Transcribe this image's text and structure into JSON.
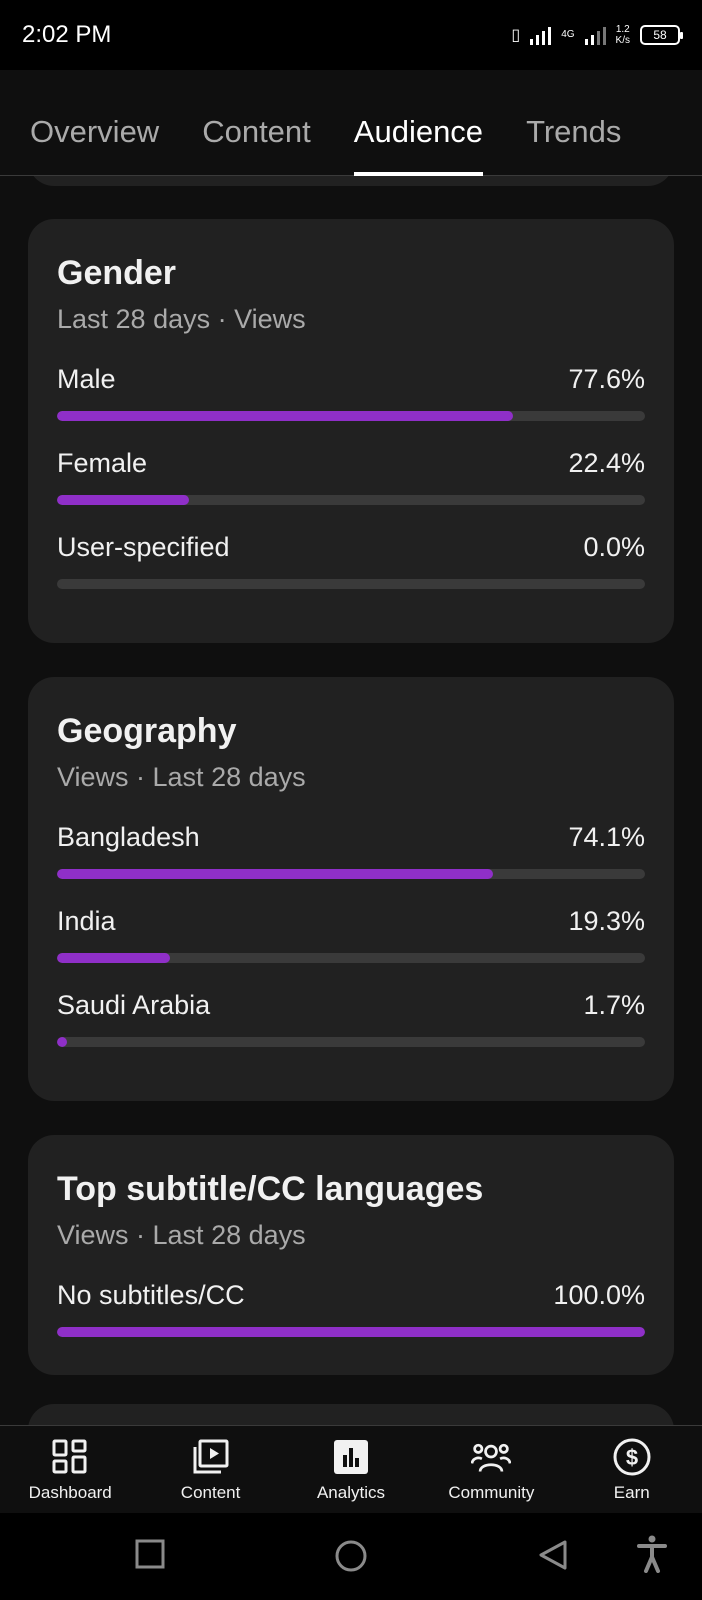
{
  "status_bar": {
    "time": "2:02 PM",
    "network_type": "4G",
    "net_speed_value": "1.2",
    "net_speed_unit": "K/s",
    "battery": "58"
  },
  "tabs": [
    {
      "label": "Overview",
      "active": false
    },
    {
      "label": "Content",
      "active": false
    },
    {
      "label": "Audience",
      "active": true
    },
    {
      "label": "Trends",
      "active": false
    }
  ],
  "gender": {
    "title": "Gender",
    "subtitle": "Last 28 days · Views",
    "rows": [
      {
        "label": "Male",
        "value": "77.6%",
        "fraction": 0.776
      },
      {
        "label": "Female",
        "value": "22.4%",
        "fraction": 0.224
      },
      {
        "label": "User-specified",
        "value": "0.0%",
        "fraction": 0.0
      }
    ]
  },
  "geography": {
    "title": "Geography",
    "subtitle": "Views · Last 28 days",
    "rows": [
      {
        "label": "Bangladesh",
        "value": "74.1%",
        "fraction": 0.741
      },
      {
        "label": "India",
        "value": "19.3%",
        "fraction": 0.193
      },
      {
        "label": "Saudi Arabia",
        "value": "1.7%",
        "fraction": 0.017
      }
    ]
  },
  "subtitles": {
    "title": "Top subtitle/CC languages",
    "subtitle": "Views · Last 28 days",
    "rows": [
      {
        "label": "No subtitles/CC",
        "value": "100.0%",
        "fraction": 1.0
      }
    ]
  },
  "bottom_nav": [
    {
      "label": "Dashboard",
      "icon": "dashboard-icon"
    },
    {
      "label": "Content",
      "icon": "content-icon"
    },
    {
      "label": "Analytics",
      "icon": "analytics-icon",
      "active": true
    },
    {
      "label": "Community",
      "icon": "community-icon"
    },
    {
      "label": "Earn",
      "icon": "earn-icon"
    }
  ],
  "colors": {
    "accent_bar": "#8f2fc8",
    "card_bg": "#212121",
    "page_bg": "#0f0f0f"
  }
}
